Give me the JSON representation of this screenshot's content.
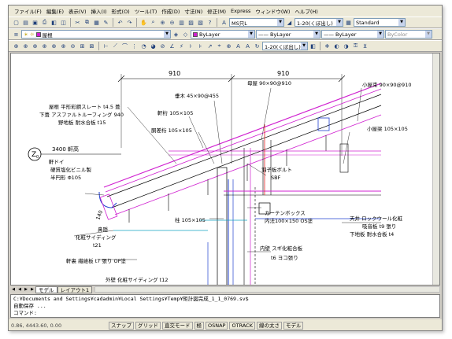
{
  "menu": [
    "ファイル(F)",
    "編集(E)",
    "表示(V)",
    "挿入(I)",
    "形式(O)",
    "ツール(T)",
    "作成(D)",
    "寸法(N)",
    "修正(M)",
    "Express",
    "ウィンドウ(W)",
    "ヘルプ(H)"
  ],
  "toolbar1": {
    "text_style": "MS只L",
    "dim_style": "1-20(くぼ出し)",
    "table_style": "Standard"
  },
  "toolbar2": {
    "layer": "屋根",
    "color": "ByLayer",
    "linetype": "ByLayer",
    "lineweight": "ByLayer",
    "plotstyle": "ByColor"
  },
  "toolbar3": {
    "dim_style": "1-20(くぼ出し)"
  },
  "drawing": {
    "dim_left": "910",
    "dim_right": "910",
    "grid_label": "Z",
    "grid_sub": "0",
    "eaves_height": "3400 軒高",
    "roof_note_1": "屋根  平形彩鋼スレート t4.5 葺",
    "roof_note_2": "下葺  アスファルトルーフィング 940",
    "roof_note_3": "野地板  耐水合板 t15",
    "rafter": "垂木  45×90@455",
    "purlin": "母屋  90×90@910",
    "small_strut": "小屋束  90×90@910",
    "eaves_beam": "軒桁  105×105",
    "small_beam": "小屋梁  105×105",
    "wall_plate": "胴差桁  105×105",
    "gutter_1": "軒ドイ",
    "gutter_2": "硬質塩化ビニル製",
    "gutter_3": "半円形  Φ105",
    "bolt_1": "羽子板ボルト",
    "bolt_2": "SBF",
    "dim_140": "140",
    "nose": "鼻隠",
    "nose_2": "化粧サイディング",
    "nose_3": "t21",
    "column": "柱  105×105",
    "curtain_box_1": "カーテンボックス",
    "curtain_box_2": "内法100×150 OS塗",
    "ceiling_1": "天井  ロックウール化粧",
    "ceiling_2": "吸音板 t9 張り",
    "ceiling_3": "下地板  耐水合板 t4",
    "soffit": "軒裏  繊維板 t7 張り OP塗",
    "inner_wall_1": "内壁  スギ化粧合板",
    "inner_wall_2": "t6 ヨコ張り",
    "outer_wall": "外壁  化粧サイディング t12"
  },
  "tabs": [
    "モデル",
    "レイアウト1"
  ],
  "command": {
    "line1": "C:¥Documents and Settings¥cadadmin¥Local Settings¥Temp¥矩計図完成_1_1_0769.sv$",
    "line2": "自動保存 ...",
    "line3": "コマンド:"
  },
  "status": {
    "coords": "0.86, 4443.60, 0.00",
    "buttons": [
      "スナップ",
      "グリッド",
      "直交モード",
      "極",
      "OSNAP",
      "OTRACK",
      "線の太さ",
      "モデル"
    ]
  },
  "colors": {
    "roof_magenta": "#d020d0",
    "wall_blue": "#2040d0",
    "cyan": "#10a0c0",
    "red": "#e02020"
  }
}
